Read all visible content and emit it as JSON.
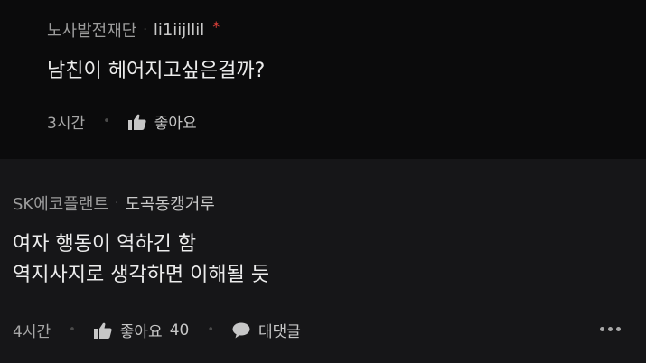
{
  "comments": [
    {
      "company": "노사발전재단",
      "separator": "·",
      "nickname": "li1iijllil",
      "author_mark": "*",
      "lines": [
        "남친이 헤어지고싶은걸까?"
      ],
      "time": "3시간",
      "like_label": "좋아요",
      "like_count": ""
    },
    {
      "company": "SK에코플랜트",
      "separator": "·",
      "nickname": "도곡동캥거루",
      "lines": [
        "여자 행동이 역하긴 함",
        "역지사지로 생각하면 이해될 듯"
      ],
      "time": "4시간",
      "like_label": "좋아요",
      "like_count": "40",
      "reply_label": "대댓글"
    }
  ],
  "icons": {
    "like": "thumbs-up-icon",
    "reply": "speech-bubble-icon",
    "more": "more-horizontal-icon"
  },
  "colors": {
    "background": "#000000",
    "comment1_bg": "#0b0b0c",
    "comment2_bg": "#161618",
    "author_mark": "#e0403a"
  }
}
